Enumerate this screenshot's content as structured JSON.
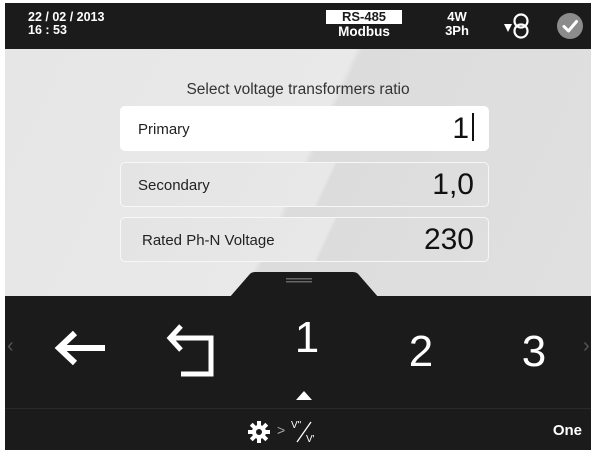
{
  "header": {
    "date": "22 / 02 / 2013",
    "time": "16 : 53",
    "protocol_top": "RS-485",
    "protocol_bottom": "Modbus",
    "wiring_top": "4W",
    "wiring_bottom": "3Ph",
    "transformer_icon": "transformer-icon",
    "status_icon": "check-circle-icon"
  },
  "main": {
    "title": "Select voltage transformers ratio",
    "fields": [
      {
        "label": "Primary",
        "value": "1",
        "active": true
      },
      {
        "label": "Secondary",
        "value": "1,0",
        "active": false
      },
      {
        "label": "Rated Ph-N Voltage",
        "value": "230",
        "active": false
      }
    ]
  },
  "keypad": {
    "back_icon": "arrow-left-icon",
    "undo_icon": "return-arrow-icon",
    "keys": [
      "1",
      "2",
      "3"
    ],
    "selected_key_indicator": "triangle-up-icon",
    "prev_icon": "chevron-left-icon",
    "next_icon": "chevron-right-icon"
  },
  "footer": {
    "breadcrumb_settings_icon": "gear-icon",
    "breadcrumb_separator": ">",
    "breadcrumb_ratio_icon": "voltage-ratio-icon",
    "mode_label": "One"
  },
  "colors": {
    "dark_background": "#1b1b1b",
    "panel_background": "#e6e6e6",
    "active_field": "#ffffff",
    "text_light": "#ffffff"
  }
}
